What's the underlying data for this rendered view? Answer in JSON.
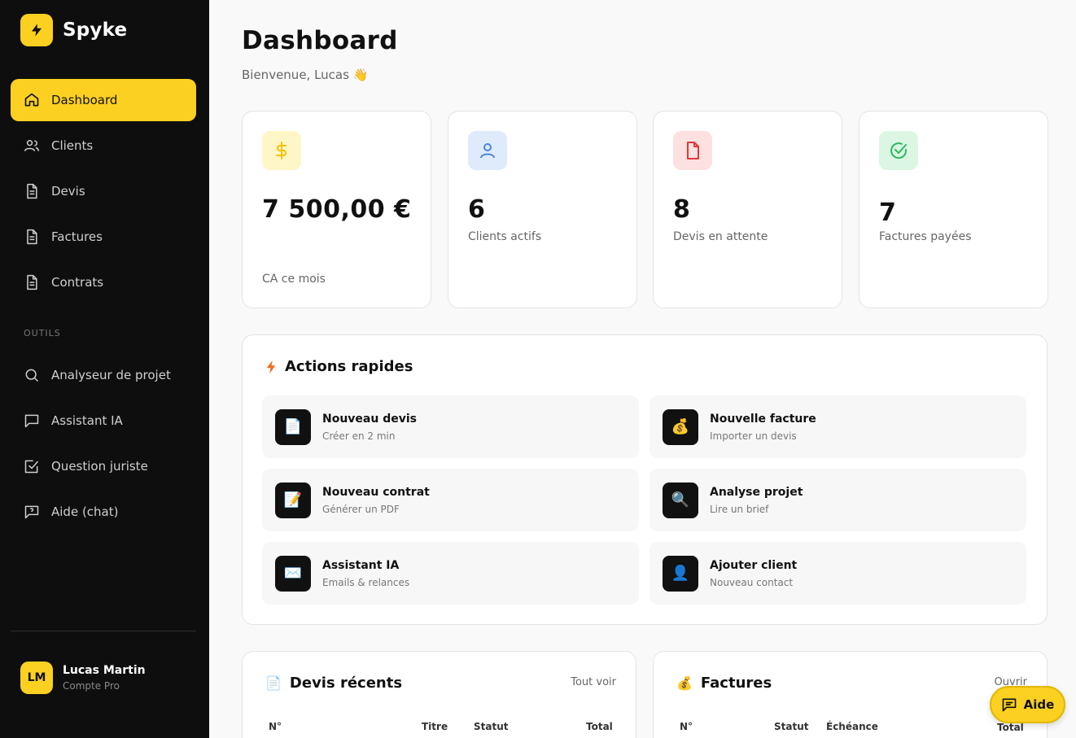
{
  "brand": {
    "name": "Spyke"
  },
  "sidebar": {
    "items": [
      {
        "label": "Dashboard",
        "icon": "home-icon"
      },
      {
        "label": "Clients",
        "icon": "users-icon"
      },
      {
        "label": "Devis",
        "icon": "document-icon"
      },
      {
        "label": "Factures",
        "icon": "document-icon"
      },
      {
        "label": "Contrats",
        "icon": "document-icon"
      }
    ],
    "section_label": "OUTILS",
    "tools": [
      {
        "label": "Analyseur de projet",
        "icon": "search-icon"
      },
      {
        "label": "Assistant IA",
        "icon": "chat-icon"
      },
      {
        "label": "Question juriste",
        "icon": "checkbox-icon"
      },
      {
        "label": "Aide (chat)",
        "icon": "chat-help-icon"
      }
    ],
    "user": {
      "initials": "LM",
      "name": "Lucas Martin",
      "plan": "Compte Pro"
    }
  },
  "header": {
    "title": "Dashboard",
    "welcome": "Bienvenue, Lucas 👋"
  },
  "stats": [
    {
      "value": "7 500,00 €",
      "label": "CA ce mois",
      "icon": "dollar-icon",
      "color": "#f2c200",
      "bg": "#fff6c7"
    },
    {
      "value": "6",
      "label": "Clients actifs",
      "icon": "user-icon",
      "color": "#4a87d6",
      "bg": "#dfeafb"
    },
    {
      "value": "8",
      "label": "Devis en attente",
      "icon": "file-icon",
      "color": "#e0383a",
      "bg": "#fde0e0"
    },
    {
      "value": "7",
      "label": "Factures payées",
      "icon": "check-circle-icon",
      "color": "#2db862",
      "bg": "#dcf6e4"
    }
  ],
  "quick_actions": {
    "title": "Actions rapides",
    "items": [
      {
        "title": "Nouveau devis",
        "sub": "Créer en 2 min",
        "emoji": "📄"
      },
      {
        "title": "Nouvelle facture",
        "sub": "Importer un devis",
        "emoji": "💰"
      },
      {
        "title": "Nouveau contrat",
        "sub": "Générer un PDF",
        "emoji": "📝"
      },
      {
        "title": "Analyse projet",
        "sub": "Lire un brief",
        "emoji": "🔍"
      },
      {
        "title": "Assistant IA",
        "sub": "Emails & relances",
        "emoji": "✉️"
      },
      {
        "title": "Ajouter client",
        "sub": "Nouveau contact",
        "emoji": "👤"
      }
    ]
  },
  "recent_quotes": {
    "title": "Devis récents",
    "emoji": "📄",
    "link": "Tout voir",
    "columns": [
      "N°",
      "Titre",
      "Statut",
      "Total"
    ]
  },
  "invoices": {
    "title": "Factures",
    "emoji": "💰",
    "link": "Ouvrir",
    "columns": [
      "N°",
      "Statut",
      "Échéance",
      "Total"
    ]
  },
  "help_button": {
    "label": "Aide"
  },
  "colors": {
    "accent": "#fbd020",
    "sidebar_bg": "#0e0e0e"
  }
}
